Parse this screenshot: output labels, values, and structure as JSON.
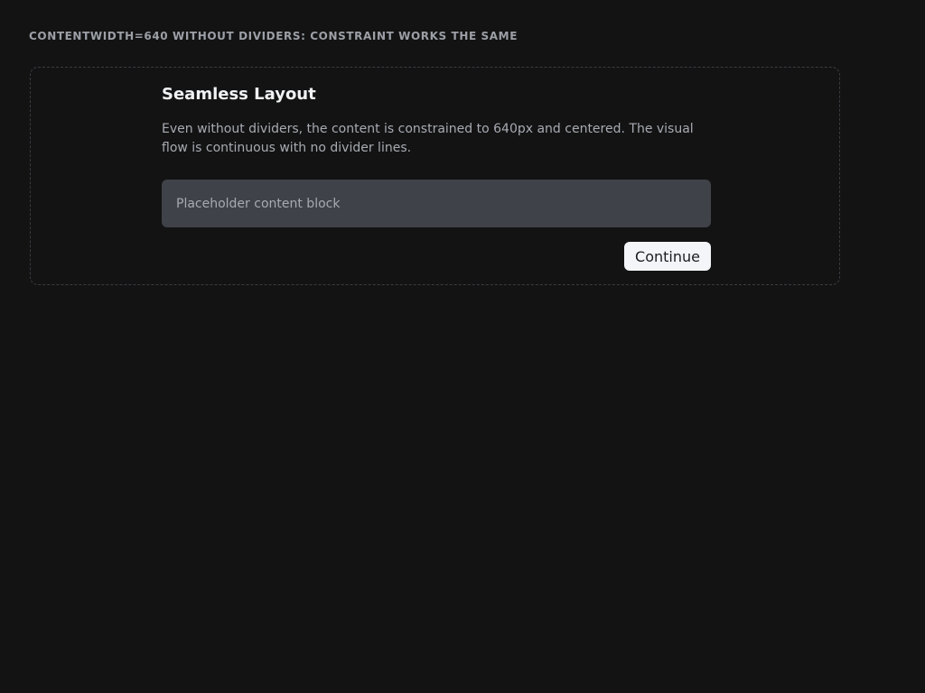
{
  "section": {
    "label": "CONTENTWIDTH=640 WITHOUT DIVIDERS: CONSTRAINT WORKS THE SAME"
  },
  "card": {
    "title": "Seamless Layout",
    "description": "Even without dividers, the content is constrained to 640px and centered. The visual flow is continuous with no divider lines.",
    "placeholder_text": "Placeholder content block",
    "continue_label": "Continue"
  },
  "colors": {
    "background": "#131314",
    "block": "#3f4248",
    "button": "#f3f5f8"
  }
}
